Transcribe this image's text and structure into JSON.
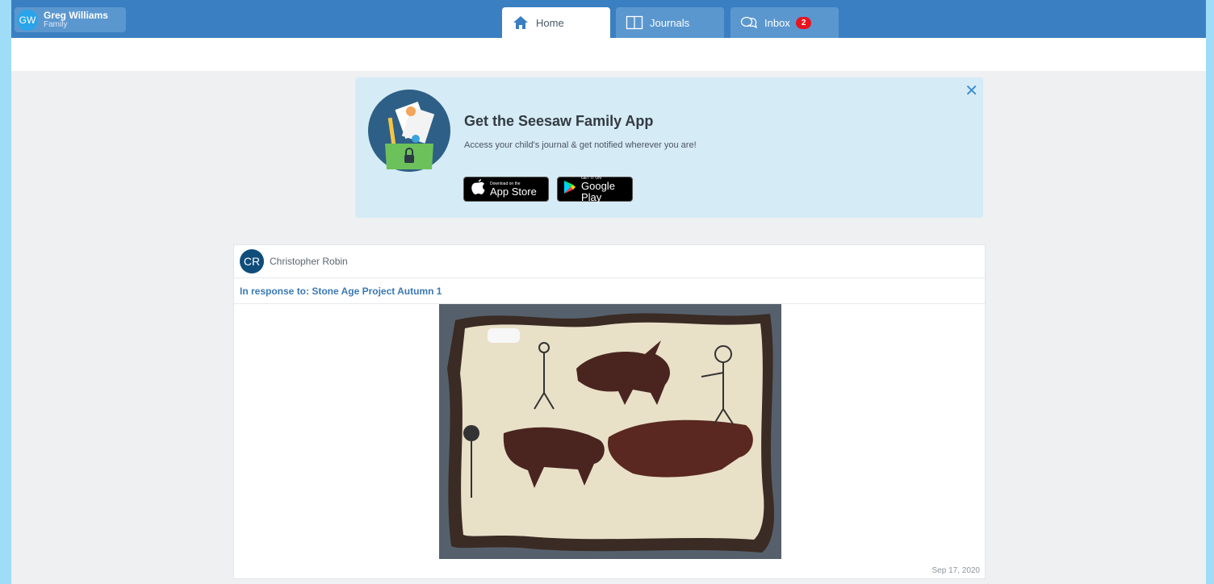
{
  "header": {
    "user": {
      "initials": "GW",
      "name": "Greg Williams",
      "role": "Family"
    },
    "tabs": [
      {
        "label": "Home",
        "icon": "home-icon"
      },
      {
        "label": "Journals",
        "icon": "journal-icon"
      },
      {
        "label": "Inbox",
        "icon": "chat-bubbles-icon",
        "badge": "2"
      }
    ]
  },
  "banner": {
    "title": "Get the Seesaw Family App",
    "subtitle": "Access your child's journal & get notified wherever you are!",
    "apple": {
      "small": "Download on the",
      "big": "App Store"
    },
    "google": {
      "small": "GET IT ON",
      "big": "Google Play"
    },
    "close_icon": "close-icon"
  },
  "post": {
    "author_initials": "CR",
    "author_name": "Christopher Robin",
    "response": "In response to: Stone Age Project Autumn 1",
    "date": "Sep 17, 2020"
  },
  "colors": {
    "topbar": "#3a7fc1",
    "accent": "#3b79b5",
    "badge": "#e8141e"
  }
}
